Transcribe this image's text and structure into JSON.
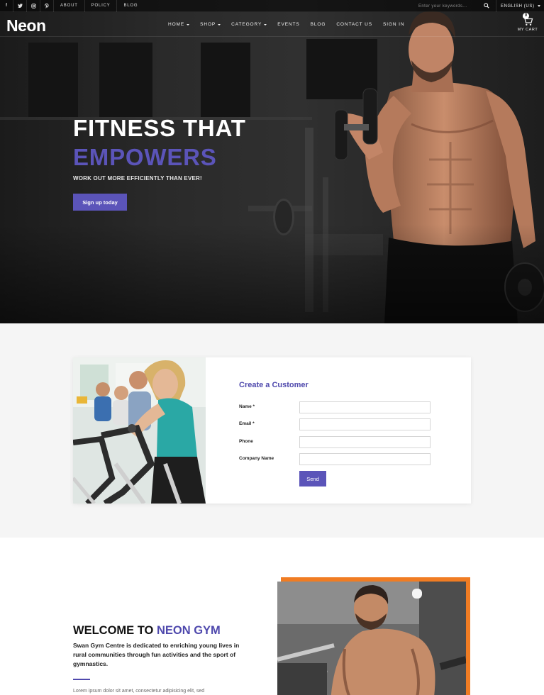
{
  "topbar": {
    "social": [
      "f",
      "t",
      "ig",
      "p"
    ],
    "links": [
      "ABOUT",
      "POLICY",
      "BLOG"
    ],
    "search_placeholder": "Enter your keywords...",
    "language": "ENGLISH (US)"
  },
  "nav": {
    "logo": "Neon",
    "items": [
      "HOME",
      "SHOP",
      "CATEGORY",
      "EVENTS",
      "BLOG",
      "CONTACT US",
      "SIGN IN"
    ],
    "cart_count": "0",
    "cart_label": "MY CART"
  },
  "hero": {
    "line1": "FITNESS THAT",
    "line2": "EMPOWERS",
    "tagline": "WORK OUT MORE EFFICIENTLY THAN EVER!",
    "button": "Sign up today"
  },
  "form": {
    "title": "Create a Customer",
    "fields": [
      {
        "label": "Name *",
        "value": ""
      },
      {
        "label": "Email *",
        "value": ""
      },
      {
        "label": "Phone",
        "value": ""
      },
      {
        "label": "Company Name",
        "value": ""
      }
    ],
    "submit": "Send"
  },
  "welcome": {
    "title_plain": "WELCOME TO ",
    "title_accent": "NEON GYM",
    "description": "Swan Gym Centre is dedicated to enriching young lives in rural communities through fun activities and the sport of gymnastics.",
    "lorem": "Lorem ipsum dolor sit amet, consectetur adipisicing elit, sed"
  },
  "colors": {
    "accent": "#5b54b9",
    "orange": "#f07c23",
    "hero_dark": "#1e1e1e",
    "section_bg": "#f5f5f5"
  }
}
